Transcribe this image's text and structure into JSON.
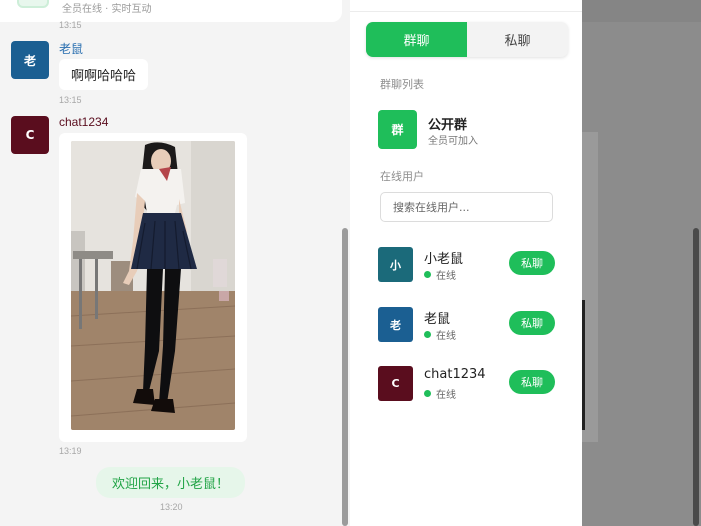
{
  "chat": {
    "header_subtitle": "全员在线 · 实时互动",
    "messages": [
      {
        "time": "13:15"
      },
      {
        "sender": "老鼠",
        "avatar_char": "老",
        "avatar_color": "#1b5f92",
        "name_color": "#2a6fb0",
        "text": "啊啊哈哈哈",
        "time": "13:15"
      },
      {
        "sender": "chat1234",
        "avatar_char": "C",
        "avatar_color": "#5a0d1e",
        "name_color": "#5a0d1e",
        "image_alt": "photo",
        "time": "13:19"
      }
    ],
    "system_message": "欢迎回来，小老鼠！",
    "system_time": "13:20"
  },
  "drawer": {
    "tabs": [
      {
        "label": "群聊",
        "active": true
      },
      {
        "label": "私聊",
        "active": false
      }
    ],
    "group_section_title": "群聊列表",
    "groups": [
      {
        "avatar_char": "群",
        "name": "公开群",
        "desc": "全员可加入",
        "color": "#1fbe5a"
      }
    ],
    "online_section_title": "在线用户",
    "search_placeholder": "搜索在线用户...",
    "users": [
      {
        "avatar_char": "小",
        "name": "小老鼠",
        "status": "在线",
        "action": "私聊",
        "color": "#1b6a7a"
      },
      {
        "avatar_char": "老",
        "name": "老鼠",
        "status": "在线",
        "action": "私聊",
        "color": "#1b5f92"
      },
      {
        "avatar_char": "C",
        "name": "chat1234",
        "status": "在线",
        "action": "私聊",
        "color": "#5a0d1e"
      }
    ],
    "accent_color": "#1fbe5a"
  }
}
